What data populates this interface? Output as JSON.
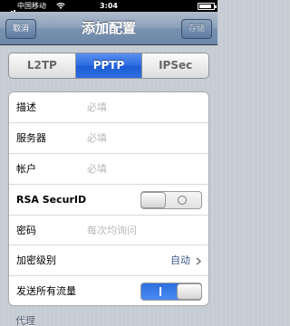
{
  "status_bar": {
    "carrier": "中国移动",
    "time": "3:04",
    "signal_icon": "signal-icon",
    "wifi_icon": "wifi-icon",
    "battery_icon": "battery-icon"
  },
  "nav": {
    "title": "添加配置",
    "left_button": "取消",
    "right_button": "存储"
  },
  "segments": {
    "items": [
      "L2TP",
      "PPTP",
      "IPSec"
    ],
    "selected": "PPTP"
  },
  "form": {
    "description": {
      "label": "描述",
      "placeholder": "必填"
    },
    "server": {
      "label": "服务器",
      "placeholder": "必填"
    },
    "account": {
      "label": "帐户",
      "placeholder": "必填"
    },
    "rsa": {
      "label": "RSA SecurID",
      "state": "off"
    },
    "password": {
      "label": "密码",
      "placeholder": "每次均询问"
    },
    "encryption": {
      "label": "加密级别",
      "value": "自动"
    },
    "send_all_traffic": {
      "label": "发送所有流量",
      "state": "on"
    }
  },
  "proxy_section": {
    "header": "代理"
  },
  "colors": {
    "accent": "#2b6be0",
    "nav_bar": "#7a92b0",
    "detail_text": "#385487",
    "placeholder": "#b8b8b8"
  }
}
